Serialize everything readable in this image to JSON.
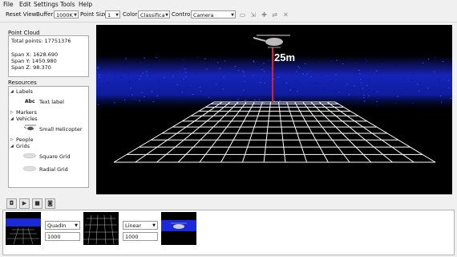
{
  "menu": [
    "File",
    "Edit",
    "Settings",
    "Tools",
    "Help"
  ],
  "toolbar": {
    "reset_view": "Reset View",
    "buffer_label": "Buffer:",
    "buffer_value": "1000K",
    "point_size_label": "Point Size:",
    "point_size_value": "1",
    "color_label": "Color:",
    "color_value": "Classifica",
    "control_label": "Control:",
    "control_value": "Camera",
    "icons": [
      "camera-icon",
      "move-icon",
      "add-icon",
      "split-icon",
      "delete-icon"
    ]
  },
  "point_cloud": {
    "title": "Point Cloud",
    "total_points": "Total points: 17751376",
    "span_x": "Span X: 1628.690",
    "span_y": "Span Y: 1450.980",
    "span_z": "Span Z: 98.370"
  },
  "resources": {
    "title": "Resources",
    "labels_cat": "Labels",
    "text_label_icon": "Abc",
    "text_label": "Text label",
    "markers_cat": "Markers",
    "vehicles_cat": "Vehicles",
    "small_helicopter": "Small Helicopter",
    "people_cat": "People",
    "grids_cat": "Grids",
    "square_grid": "Square Grid",
    "radial_grid": "Radial Grid"
  },
  "viewport": {
    "altitude_label": "25m",
    "marker_color": "#e0201a",
    "cloud_color": "#1a2ad8"
  },
  "timeline": {
    "interp_1": "QuadIn",
    "duration_1": "1000",
    "interp_2": "Linear",
    "duration_2": "1000"
  }
}
